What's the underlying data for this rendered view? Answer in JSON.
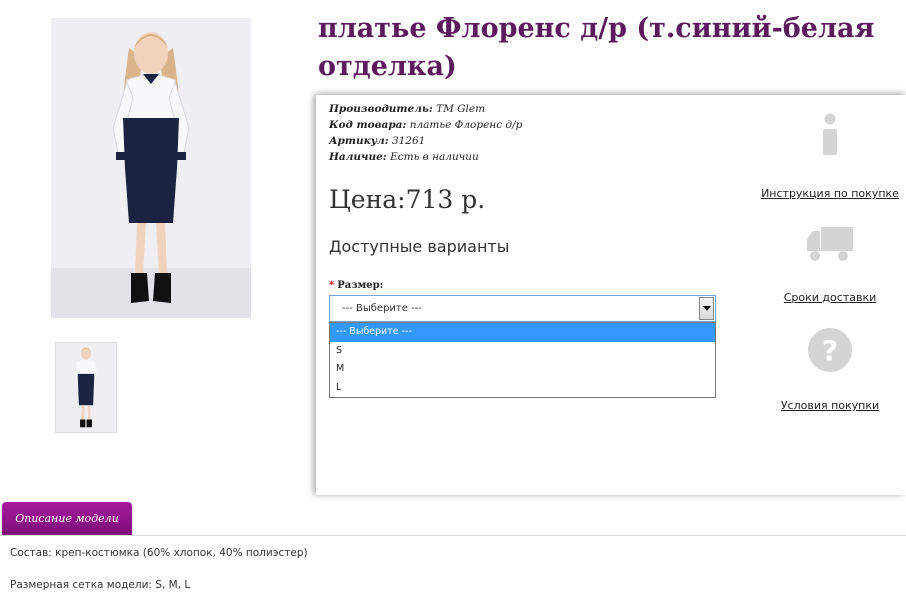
{
  "product": {
    "title": "платье Флоренс д/р (т.синий-белая отделка)",
    "meta": [
      {
        "label": "Производитель:",
        "value": "TM Glem"
      },
      {
        "label": "Код товара:",
        "value": "платье Флоренс д/р"
      },
      {
        "label": "Артикул:",
        "value": "31261"
      },
      {
        "label": "Наличие:",
        "value": "Есть в наличии"
      }
    ],
    "price": "Цена:713 р.",
    "variants_title": "Доступные варианты",
    "size_label": "Размер:",
    "size_required_mark": "*",
    "select_value": "--- Выберите ---",
    "options": [
      "--- Выберите ---",
      "S",
      "M",
      "L"
    ]
  },
  "side_links": [
    {
      "label": "Инструкция по покупке",
      "icon": "info-icon"
    },
    {
      "label": "Сроки доставки",
      "icon": "truck-icon"
    },
    {
      "label": "Условия покупки",
      "icon": "question-icon"
    }
  ],
  "tabs": {
    "description": "Описание модели"
  },
  "description": {
    "composition": "Состав: креп-костюмка (60% хлопок, 40% полиэстер)",
    "sizes": "Размерная сетка модели: S, M, L"
  },
  "colors": {
    "title": "#5b1a5c",
    "tab": "#8e1489",
    "select_highlight": "#3399ff"
  }
}
